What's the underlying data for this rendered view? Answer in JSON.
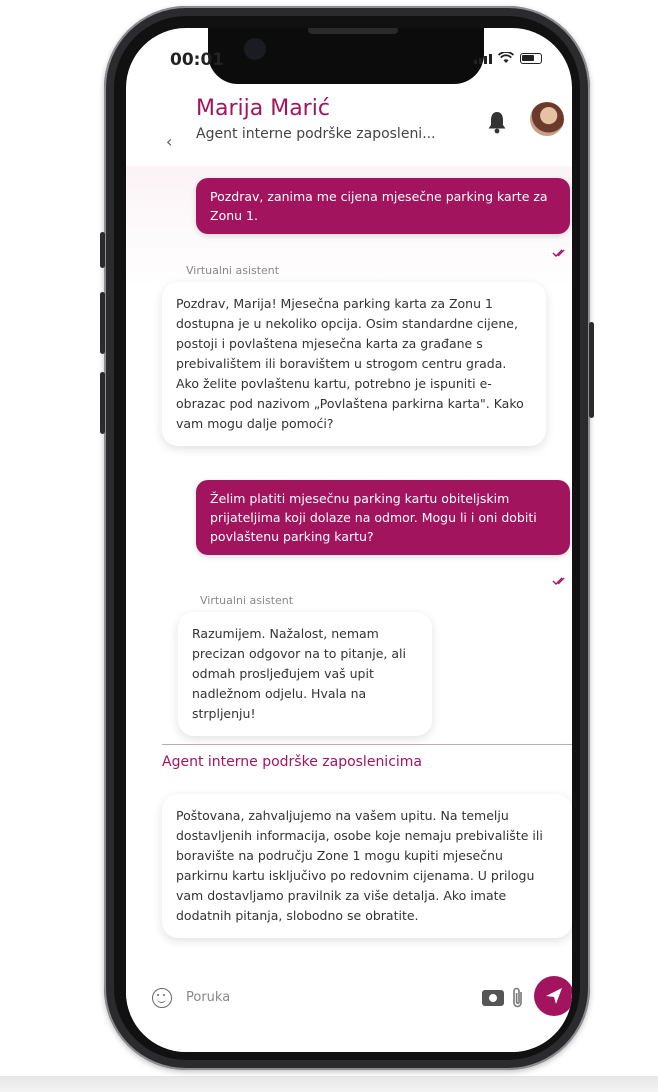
{
  "status_bar": {
    "time": "00:01"
  },
  "header": {
    "back_icon": "‹",
    "contact_name": "Marija Marić",
    "subtitle": "Agent interne podrške zaposleni..."
  },
  "messages": {
    "m1": {
      "text": "Pozdrav, zanima me cijena mjesečne parking karte za Zonu 1."
    },
    "m2": {
      "sender": "Virtualni asistent",
      "text": "Pozdrav, Marija! Mjesečna parking karta za Zonu 1 dostupna je u nekoliko opcija. Osim standardne cijene, postoji i povlaštena mjesečna karta za građane s prebivalištem ili boravištem u strogom centru grada. Ako želite povlaštenu kartu, potrebno je ispuniti e-obrazac pod nazivom „Povlaštena parkirna karta\". Kako vam mogu dalje pomoći?"
    },
    "m3": {
      "text": "Želim platiti mjesečnu parking kartu obiteljskim prijateljima koji dolaze na odmor. Mogu li i oni dobiti povlaštenu parking kartu?"
    },
    "m4": {
      "sender": "Virtualni asistent",
      "text": "Razumijem. Nažalost, nemam precizan odgovor na to pitanje, ali odmah prosljeđujem vaš upit nadležnom odjelu. Hvala na strpljenju!"
    },
    "agent_heading": "Agent interne podrške zaposlenicima",
    "m5": {
      "text": "Poštovana, zahvaljujemo na vašem upitu. Na temelju dostavljenih informacija, osobe koje nemaju prebivalište ili boravište na području Zone 1 mogu kupiti mjesečnu parkirnu kartu isključivo po redovnim cijenama. U prilogu vam dostavljamo pravilnik za više detalja. Ako imate dodatnih pitanja, slobodno se obratite."
    }
  },
  "input": {
    "placeholder": "Poruka"
  },
  "colors": {
    "accent": "#a3145f",
    "frame": "#2b2b2e"
  },
  "icons": [
    "back-icon",
    "bell-icon",
    "avatar",
    "read-receipt-icon",
    "emoji-icon",
    "camera-icon",
    "attach-icon",
    "send-icon"
  ]
}
